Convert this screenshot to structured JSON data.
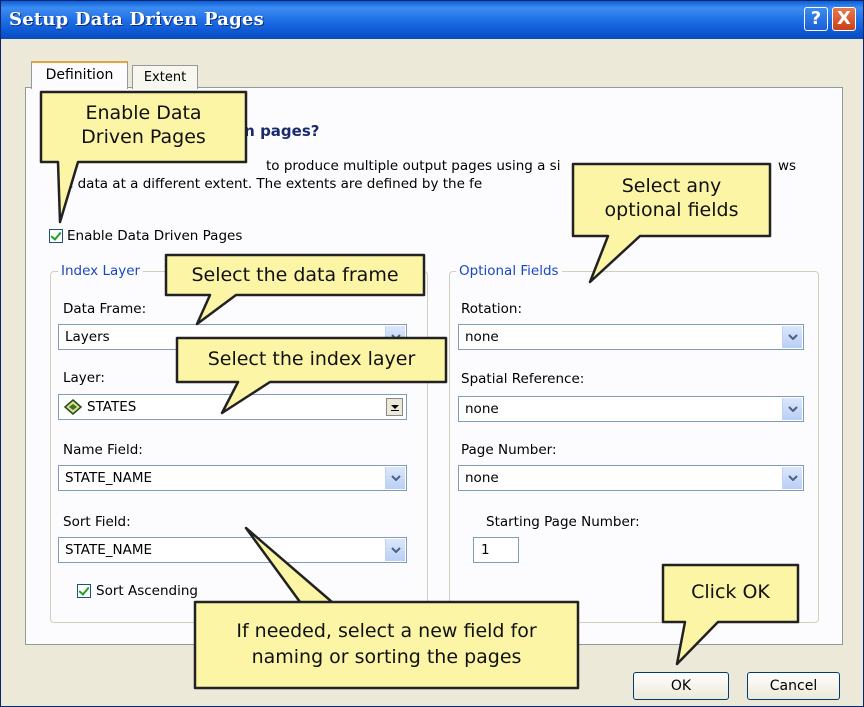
{
  "window": {
    "title": "Setup Data Driven Pages",
    "help_label": "?",
    "close_label": "X"
  },
  "tabs": [
    {
      "label": "Definition",
      "active": true
    },
    {
      "label": "Extent",
      "active": false
    }
  ],
  "definition": {
    "heading": "en pages?",
    "description_line1": "to produce multiple output pages using a si",
    "description_line1_end": "ws",
    "description_line2": "e data at a different extent.  The extents are defined by the fe",
    "enable_checkbox": {
      "label": "Enable Data Driven Pages",
      "checked": true
    }
  },
  "index_layer": {
    "legend": "Index Layer",
    "data_frame": {
      "label": "Data Frame:",
      "value": "Layers"
    },
    "layer": {
      "label": "Layer:",
      "value": "STATES"
    },
    "name_field": {
      "label": "Name Field:",
      "value": "STATE_NAME"
    },
    "sort_field": {
      "label": "Sort Field:",
      "value": "STATE_NAME"
    },
    "sort_ascending": {
      "label": "Sort Ascending",
      "checked": true
    }
  },
  "optional_fields": {
    "legend": "Optional Fields",
    "rotation": {
      "label": "Rotation:",
      "value": "none"
    },
    "spatial_reference": {
      "label": "Spatial Reference:",
      "value": "none"
    },
    "page_number": {
      "label": "Page Number:",
      "value": "none"
    },
    "starting_page_number": {
      "label": "Starting Page Number:",
      "value": "1"
    }
  },
  "buttons": {
    "ok": "OK",
    "cancel": "Cancel"
  },
  "callouts": {
    "enable": [
      "Enable Data",
      "Driven Pages"
    ],
    "optional": [
      "Select any",
      "optional fields"
    ],
    "data_frame": [
      "Select the data frame"
    ],
    "index_layer": [
      "Select the index layer"
    ],
    "new_field": [
      "If needed, select a new field for",
      "naming or sorting the pages"
    ],
    "click_ok": [
      "Click OK"
    ]
  },
  "colors": {
    "titlebar": "#0a5fd8",
    "callout_fill": "#fdf5a6",
    "group_legend": "#1a48c4",
    "dialog_bg": "#ece9d8"
  }
}
